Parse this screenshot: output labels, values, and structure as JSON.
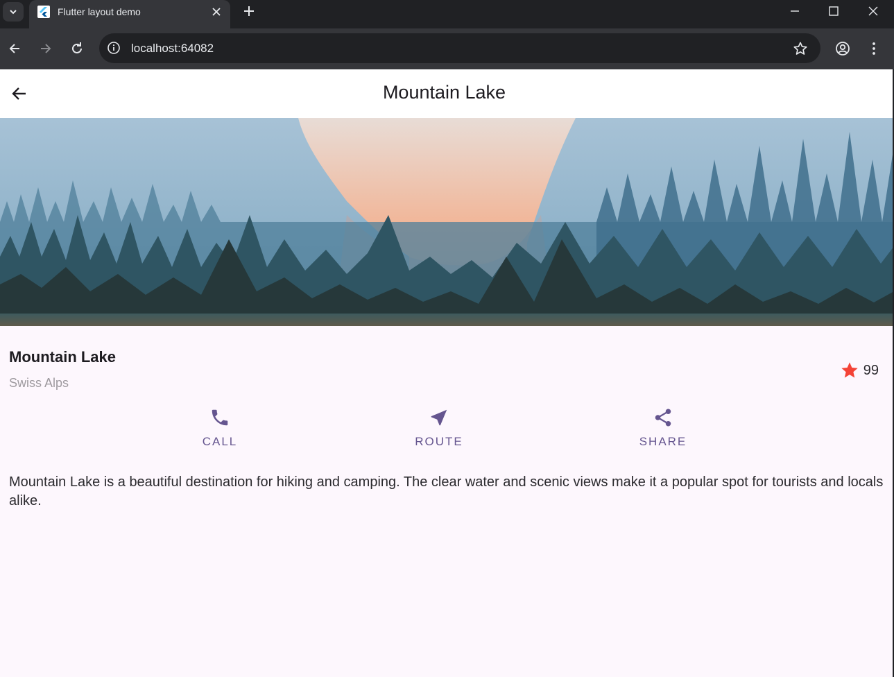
{
  "browser": {
    "tab_title": "Flutter layout demo",
    "url": "localhost:64082"
  },
  "appbar": {
    "title": "Mountain Lake"
  },
  "hero": {
    "alt": "Mountain Lake"
  },
  "place": {
    "name": "Mountain Lake",
    "location": "Swiss Alps",
    "rating_count": "99",
    "star_icon": "star-icon",
    "star_color": "#f44336"
  },
  "actions": [
    {
      "label": "CALL",
      "icon": "phone-icon"
    },
    {
      "label": "ROUTE",
      "icon": "near-me-icon"
    },
    {
      "label": "SHARE",
      "icon": "share-icon"
    }
  ],
  "description": "Mountain Lake is a beautiful destination for hiking and camping. The clear water and scenic views make it a popular spot for tourists and locals alike.",
  "colors": {
    "accent": "#65558f",
    "background": "#fdf7fd",
    "appbar": "#ffffff"
  }
}
